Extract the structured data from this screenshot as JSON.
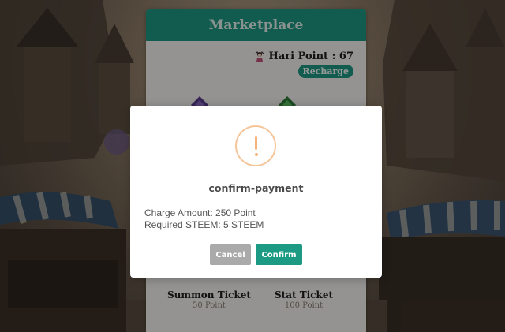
{
  "marketplace": {
    "title": "Marketplace",
    "points_label": "Hari Point : 67",
    "recharge_label": "Recharge",
    "tickets": [
      {
        "name": "Summon Ticket",
        "price": "50 Point"
      },
      {
        "name": "Stat Ticket",
        "price": "100 Point"
      }
    ]
  },
  "modal": {
    "icon": "warning-icon",
    "title": "confirm-payment",
    "lines": [
      "Charge Amount: 250 Point",
      "Required STEEM: 5 STEEM"
    ],
    "cancel_label": "Cancel",
    "confirm_label": "Confirm"
  },
  "colors": {
    "accent": "#1d9a83",
    "warning": "#f3b47b",
    "cancel": "#aaaaaa"
  }
}
